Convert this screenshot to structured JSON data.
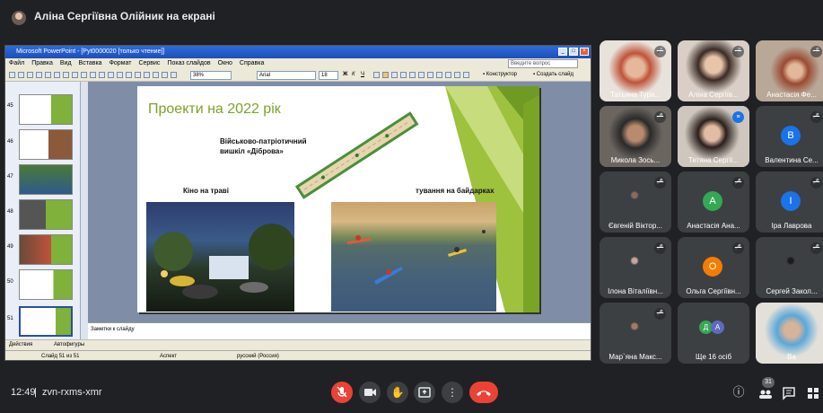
{
  "meet": {
    "presenter_label": "Аліна Сергіївна Олійник на екрані",
    "time": "12:49",
    "separator": "|",
    "meeting_code": "zvn-rxms-xmr",
    "participant_count": "31"
  },
  "ppt": {
    "window_title": "Microsoft PowerPoint - [Pyt0000020 [только чтение]]",
    "menu": [
      "Файл",
      "Правка",
      "Вид",
      "Вставка",
      "Формат",
      "Сервис",
      "Показ слайдов",
      "Окно",
      "Справка"
    ],
    "ask_placeholder": "Введите вопрос",
    "zoom": "38%",
    "font": "Arial",
    "font_size": "18",
    "designer_label": "Конструктор",
    "new_slide_label": "Создать слайд",
    "thumb_numbers": [
      "45",
      "46",
      "47",
      "48",
      "49",
      "50",
      "51"
    ],
    "notes_placeholder": "Заметки к слайду",
    "draw_label": "Действия",
    "autoshapes_label": "Автофигуры",
    "status_slide": "Слайд 51 из 51",
    "status_design": "Аспект",
    "status_lang": "русский (Россия)"
  },
  "slide": {
    "title": "Проекти на 2022 рік",
    "label_route_1": "Військово-патріотичний",
    "label_route_2": "вишкіл «Діброва»",
    "label_cinema": "Кіно на траві",
    "label_kayak": "тування на байдарках"
  },
  "participants": [
    {
      "name": "Татьяна Тури...",
      "muted": true,
      "kind": "photo"
    },
    {
      "name": "Аліна Сергіїв...",
      "muted": true,
      "kind": "photo"
    },
    {
      "name": "Анастасія Фе...",
      "muted": true,
      "kind": "photo"
    },
    {
      "name": "Микола Зось...",
      "muted": true,
      "kind": "photo"
    },
    {
      "name": "Тетяна Сергії...",
      "muted": false,
      "kind": "photo",
      "speaking": true
    },
    {
      "name": "Валентина Се...",
      "muted": true,
      "kind": "avatar",
      "letter": "В",
      "color": "#1a73e8"
    },
    {
      "name": "Євгеній Віктор...",
      "muted": true,
      "kind": "photo"
    },
    {
      "name": "Анастасія Ана...",
      "muted": true,
      "kind": "avatar",
      "letter": "А",
      "color": "#34a853"
    },
    {
      "name": "Іра Лаврова",
      "muted": true,
      "kind": "avatar",
      "letter": "І",
      "color": "#1a73e8"
    },
    {
      "name": "Ілона Віталіївн...",
      "muted": true,
      "kind": "photo"
    },
    {
      "name": "Ольга Сергіївн...",
      "muted": true,
      "kind": "avatar",
      "letter": "О",
      "color": "#f57c00"
    },
    {
      "name": "Сергей Закол...",
      "muted": true,
      "kind": "photo"
    },
    {
      "name": "Мар`яна Макс...",
      "muted": true,
      "kind": "photo"
    },
    {
      "name": "Ще 16 осіб",
      "muted": false,
      "kind": "more",
      "letters": [
        "Д",
        "А"
      ]
    },
    {
      "name": "Ва",
      "muted": false,
      "kind": "photo"
    }
  ],
  "icons": {
    "mic": "mic-off-icon",
    "camera": "camera-icon",
    "hand": "raise-hand-icon",
    "present": "present-icon",
    "more": "more-vert-icon",
    "leave": "call-end-icon",
    "info": "info-icon",
    "people": "people-icon",
    "chat": "chat-icon",
    "activities": "activities-icon"
  },
  "colors": {
    "meet_bg": "#202124",
    "tile_bg": "#3c4043",
    "danger": "#ea4335",
    "slide_green": "#7aa426"
  }
}
